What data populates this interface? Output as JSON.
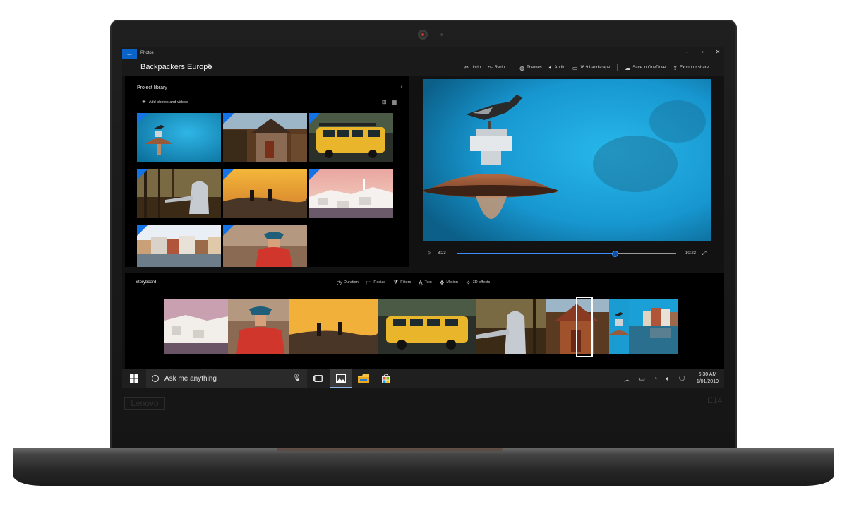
{
  "hardware": {
    "brand": "Lenovo",
    "model": "E14"
  },
  "app": {
    "name": "Photos",
    "project_title": "Backpackers Europe",
    "window_controls": [
      "–",
      "▫",
      "✕"
    ]
  },
  "toolbar": {
    "undo_label": "Undo",
    "redo_label": "Redo",
    "themes_label": "Themes",
    "audio_label": "Audio",
    "aspect_label": "16:9 Landscape",
    "onedrive_label": "Save in OneDrive",
    "export_label": "Export or share",
    "more_label": "···"
  },
  "library": {
    "title": "Project library",
    "add_label": "Add photos and videos",
    "thumbnails": [
      "bird-on-lamp",
      "wooden-house",
      "yellow-van",
      "hooded-person-forest",
      "hikers-sunset",
      "santorini-village",
      "riverside-houses",
      "person-with-hat"
    ]
  },
  "player": {
    "current_time": "8:23",
    "total_time": "10:23",
    "progress": 0.72
  },
  "storyboard": {
    "title": "Storyboard",
    "tools": [
      "Duration",
      "Resize",
      "Filters",
      "Text",
      "Motion",
      "3D effects"
    ],
    "clips": [
      "santorini-village",
      "person-with-hat",
      "hikers-sunset",
      "yellow-van",
      "hooded-person-forest",
      "wooden-house",
      "bird-on-lamp",
      "riverside-houses"
    ]
  },
  "taskbar": {
    "search_placeholder": "Ask me anything",
    "time": "6:30 AM",
    "date": "1/01/2019"
  },
  "colors": {
    "accent": "#1473e6",
    "sky": "#1ca3d8",
    "background": "#121212"
  }
}
